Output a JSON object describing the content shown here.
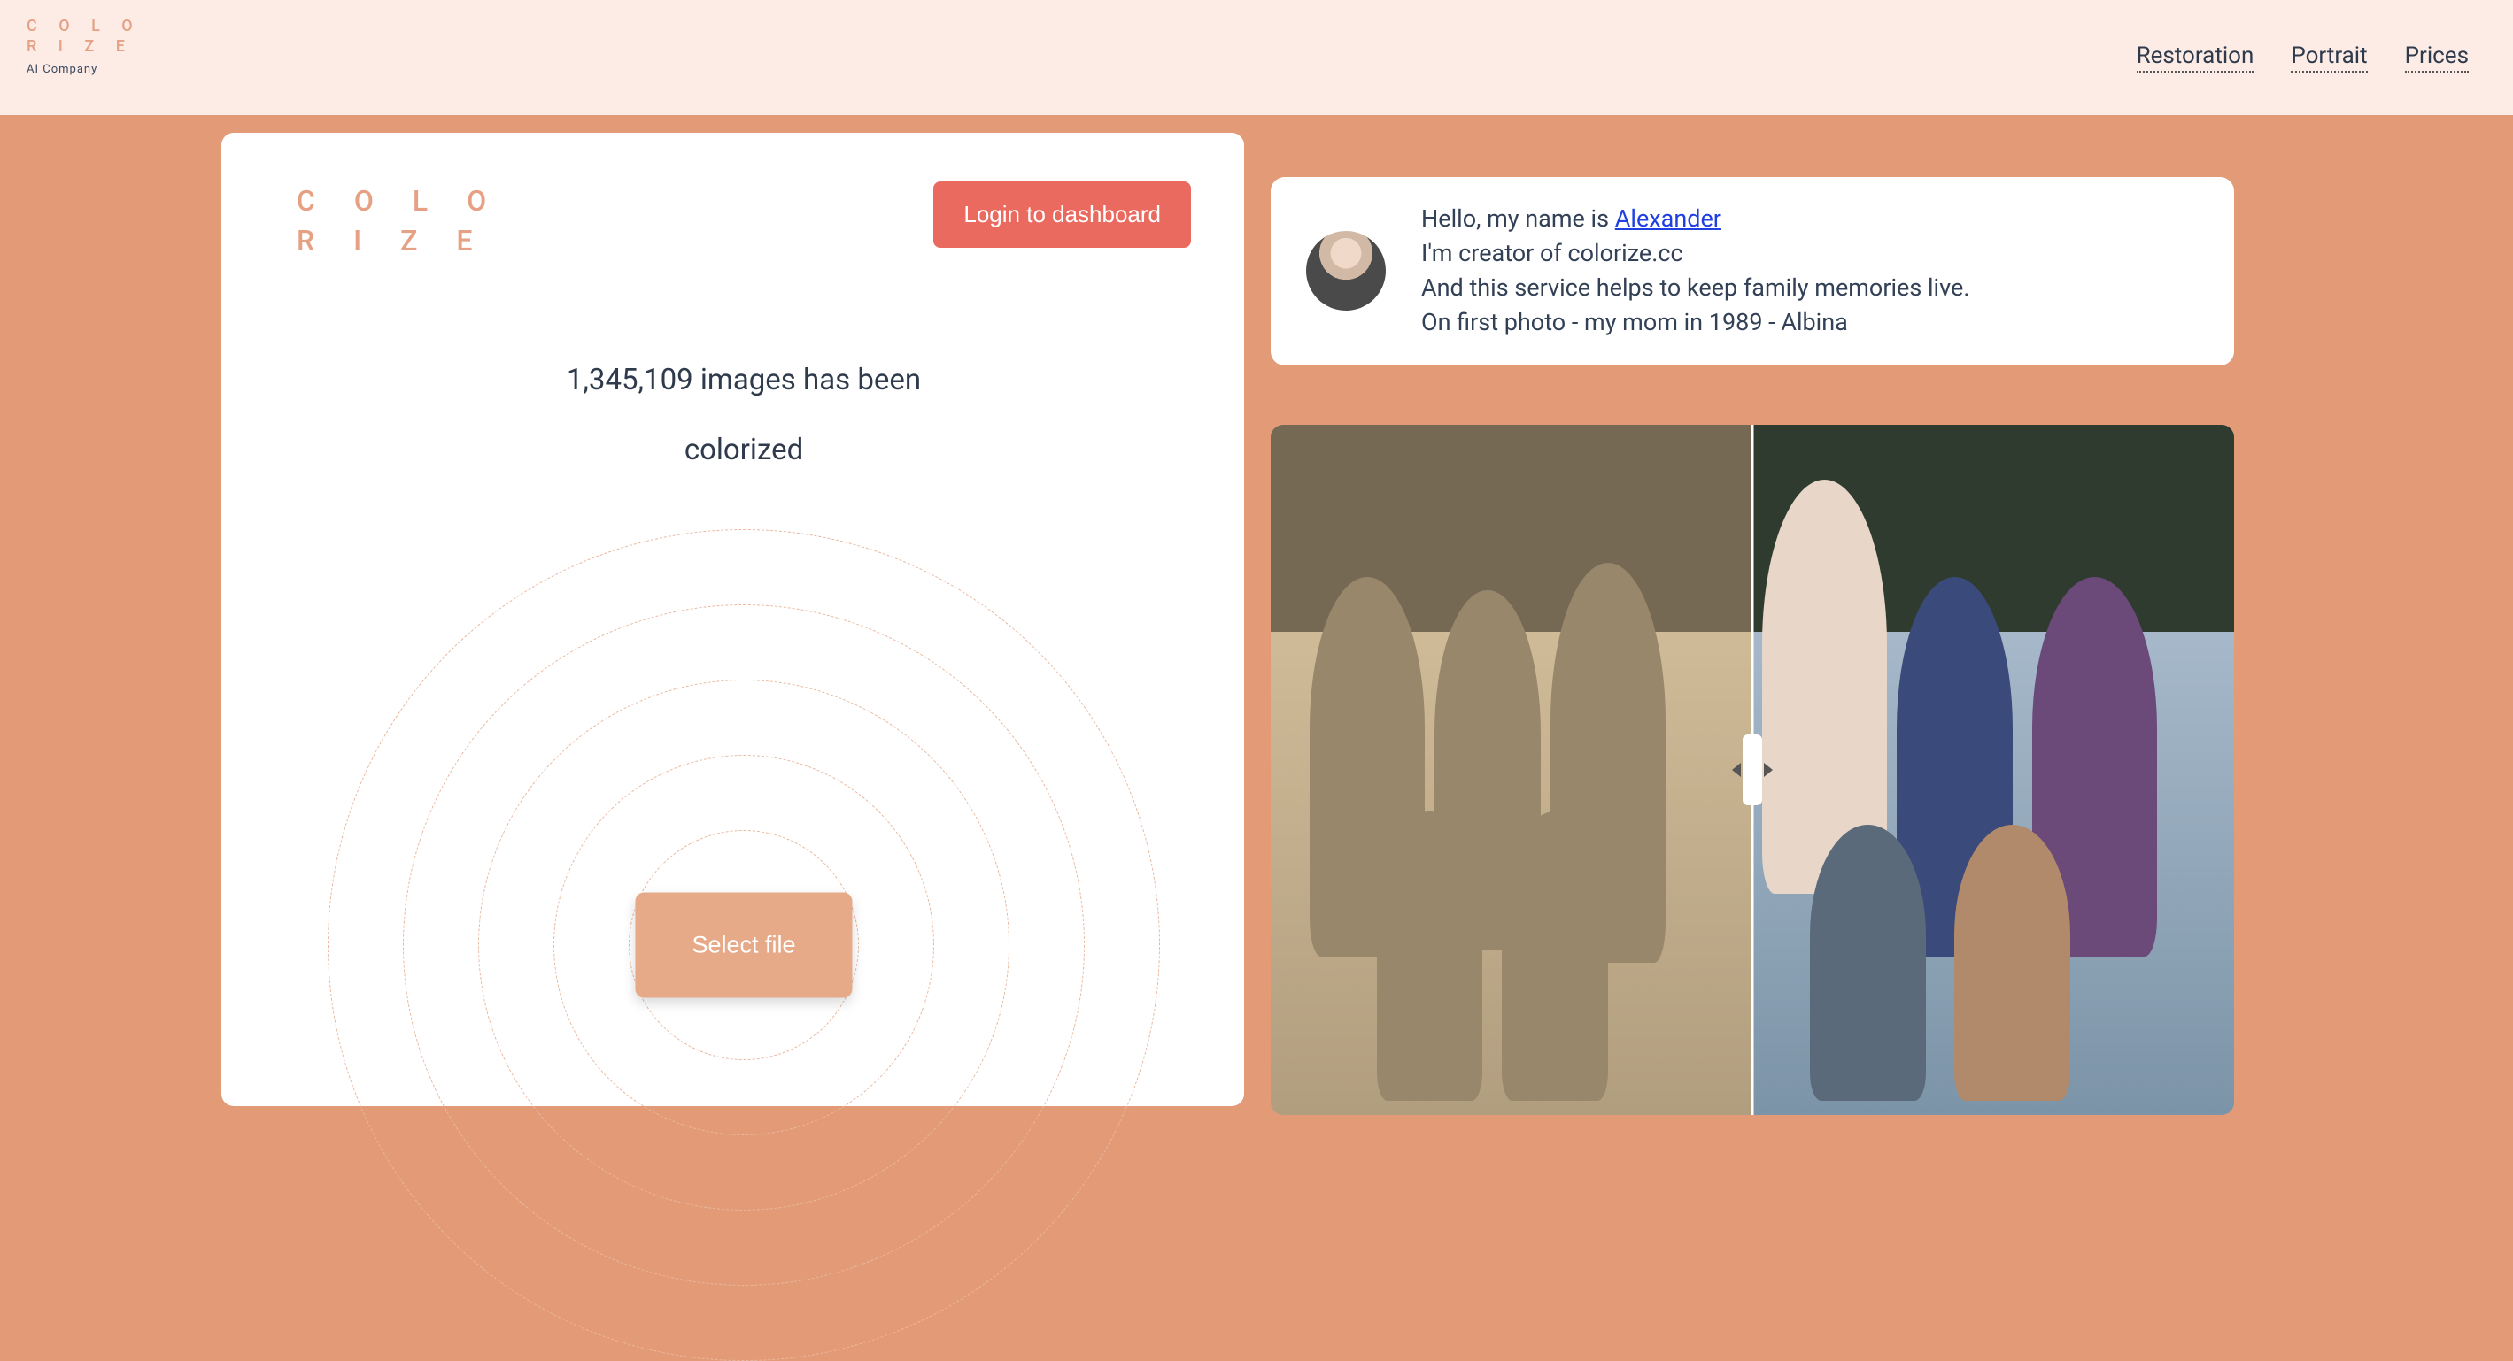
{
  "brand": {
    "line1": "C O L O",
    "line2": "R I Z E",
    "subtitle": "AI Company"
  },
  "nav": {
    "restoration": "Restoration",
    "portrait": "Portrait",
    "prices": "Prices"
  },
  "left": {
    "login_label": "Login to dashboard",
    "counter_line1": "1,345,109 images has been",
    "counter_line2": "colorized",
    "select_label": "Select file"
  },
  "intro": {
    "hello_prefix": "Hello, my name is ",
    "author_name": "Alexander",
    "line2": "I'm creator of colorize.cc",
    "line3": "And this service helps to keep family memories live.",
    "line4": "On first photo - my mom in 1989 -  Albina"
  }
}
